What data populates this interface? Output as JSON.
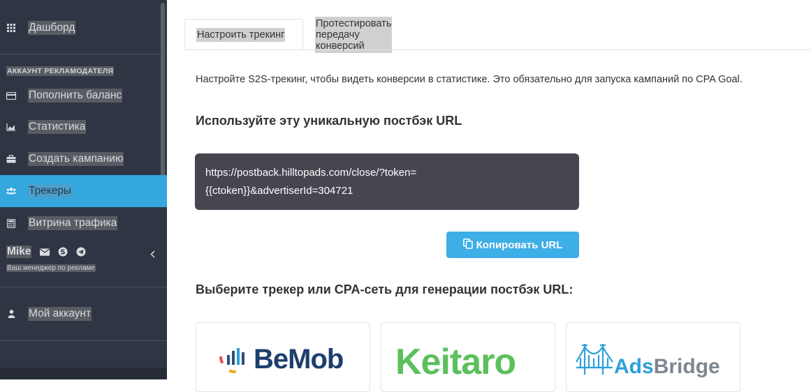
{
  "sidebar": {
    "dashboard": "Дашборд",
    "section_title": "АККАУНТ РЕКЛАМОДАТЕЛЯ",
    "items": [
      {
        "label": "Пополнить баланс",
        "icon": "credit-card-icon"
      },
      {
        "label": "Статистика",
        "icon": "area-chart-icon"
      },
      {
        "label": "Создать кампанию",
        "icon": "briefcase-icon"
      },
      {
        "label": "Трекеры",
        "icon": "users-icon",
        "active": true
      },
      {
        "label": "Витрина трафика",
        "icon": "calculator-icon"
      }
    ],
    "manager": {
      "name": "Mike",
      "subtitle": "Ваш менеджер по рекламе"
    },
    "account": "Мой аккаунт",
    "colors": {
      "bg": "#2f3543",
      "active": "#33a7de"
    }
  },
  "tabs": [
    {
      "label": "Настроить трекинг",
      "active": true
    },
    {
      "label": "Протестировать передачу конверсий",
      "active": false
    }
  ],
  "main": {
    "intro": "Настройте S2S-трекинг, чтобы видеть конверсии в статистике. Это обязательно для запуска кампаний по CPA Goal.",
    "postback_heading": "Используйте эту уникальную постбэк URL",
    "postback_url_line1": "https://postback.hilltopads.com/close/?token=",
    "postback_url_line2": "{{ctoken}}&advertiserId=304721",
    "copy_button": "Копировать URL",
    "tracker_heading": "Выберите трекер или CPA-сеть для генерации постбэк URL:",
    "trackers": [
      {
        "name": "BeMob"
      },
      {
        "name": "Keitaro"
      },
      {
        "name": "AdsBridge"
      }
    ],
    "colors": {
      "accent": "#3eaee6",
      "url_box": "#454650"
    }
  }
}
